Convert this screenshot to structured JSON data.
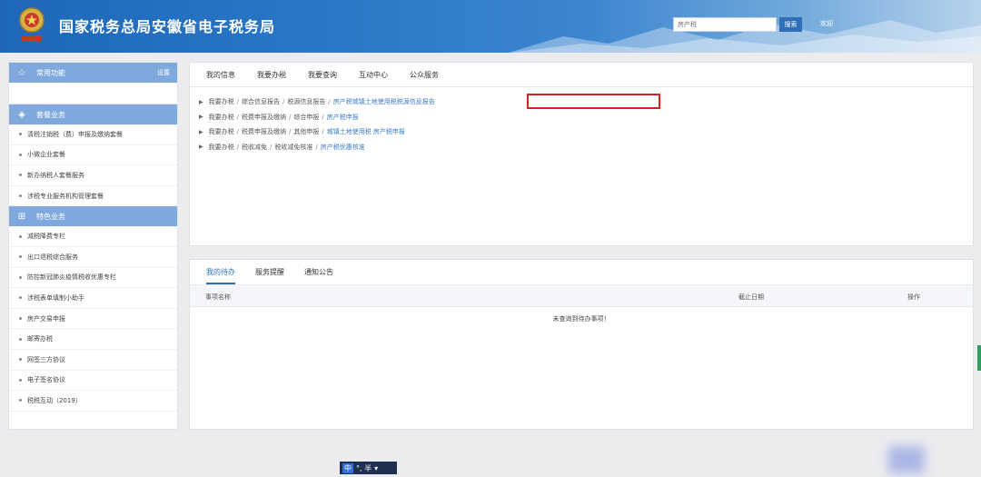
{
  "header": {
    "title": "国家税务总局安徽省电子税务局",
    "search_placeholder": "房产税",
    "search_button": "搜索",
    "welcome": "欢迎"
  },
  "sidebar": {
    "favorites_label": "常用功能",
    "settings_label": "设置",
    "section1_label": "套餐业务",
    "section1_items": [
      "清税注销税（费）申报及缴纳套餐",
      "小微企业套餐",
      "新办纳税人套餐服务",
      "涉税专业服务机构管理套餐"
    ],
    "section2_label": "特色业务",
    "section2_items": [
      "减税降费专栏",
      "出口退税综合服务",
      "防控新冠肺炎疫情税收优惠专栏",
      "涉税表单填制小助手",
      "房产交易申报",
      "邮寄办税",
      "网签三方协议",
      "电子签名协议",
      "税税互动（2019）"
    ]
  },
  "main": {
    "tabs": [
      "我的信息",
      "我要办税",
      "我要查询",
      "互动中心",
      "公众服务"
    ],
    "breadcrumbs": [
      [
        "我要办税",
        "综合信息报告",
        "税源信息报告",
        "房产税城镇土地使用税税源信息报告"
      ],
      [
        "我要办税",
        "税费申报及缴纳",
        "综合申报",
        "房产税申报"
      ],
      [
        "我要办税",
        "税费申报及缴纳",
        "其他申报",
        "城镇土地使用税 房产税申报"
      ],
      [
        "我要办税",
        "税收减免",
        "税收减免核准",
        "房产税优惠核准"
      ]
    ]
  },
  "todo": {
    "tabs": [
      "我的待办",
      "服务提醒",
      "通知公告"
    ],
    "col_name": "事项名称",
    "col_deadline": "截止日期",
    "col_action": "操作",
    "empty_text": "未查询到待办事项！"
  },
  "ime": {
    "mode": "中",
    "status": "°, 半"
  },
  "colors": {
    "accent": "#2f6fb8",
    "sidebar_header": "#7fa9dc",
    "highlight_box": "#d82020"
  }
}
